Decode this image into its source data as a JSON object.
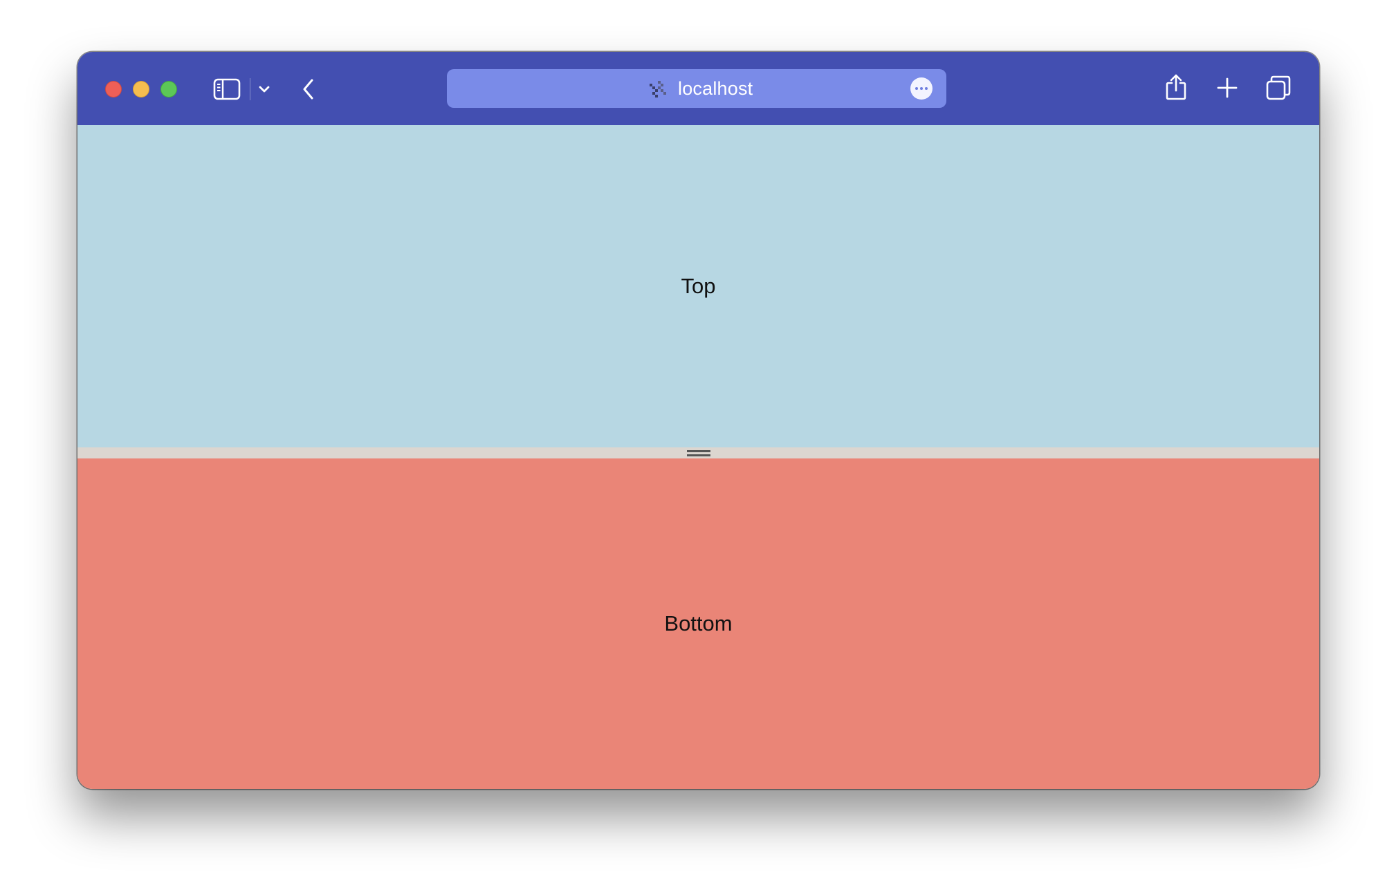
{
  "window": {
    "address": "localhost"
  },
  "toolbar": {
    "icons": {
      "close": "close-traffic-light",
      "minimize": "minimize-traffic-light",
      "zoom": "zoom-traffic-light",
      "sidebar": "sidebar-icon",
      "sidebar_menu": "chevron-down-icon",
      "back": "chevron-left-icon",
      "site": "site-favicon-icon",
      "page_menu": "ellipsis-icon",
      "share": "share-icon",
      "new_tab": "plus-icon",
      "tab_overview": "tabs-overview-icon"
    }
  },
  "panes": {
    "top_label": "Top",
    "bottom_label": "Bottom"
  },
  "colors": {
    "titlebar": "#434fb1",
    "addressbar": "#7a8be8",
    "top_pane": "#b7d7e3",
    "splitter": "#dcd6d0",
    "bottom_pane": "#ea8577"
  }
}
